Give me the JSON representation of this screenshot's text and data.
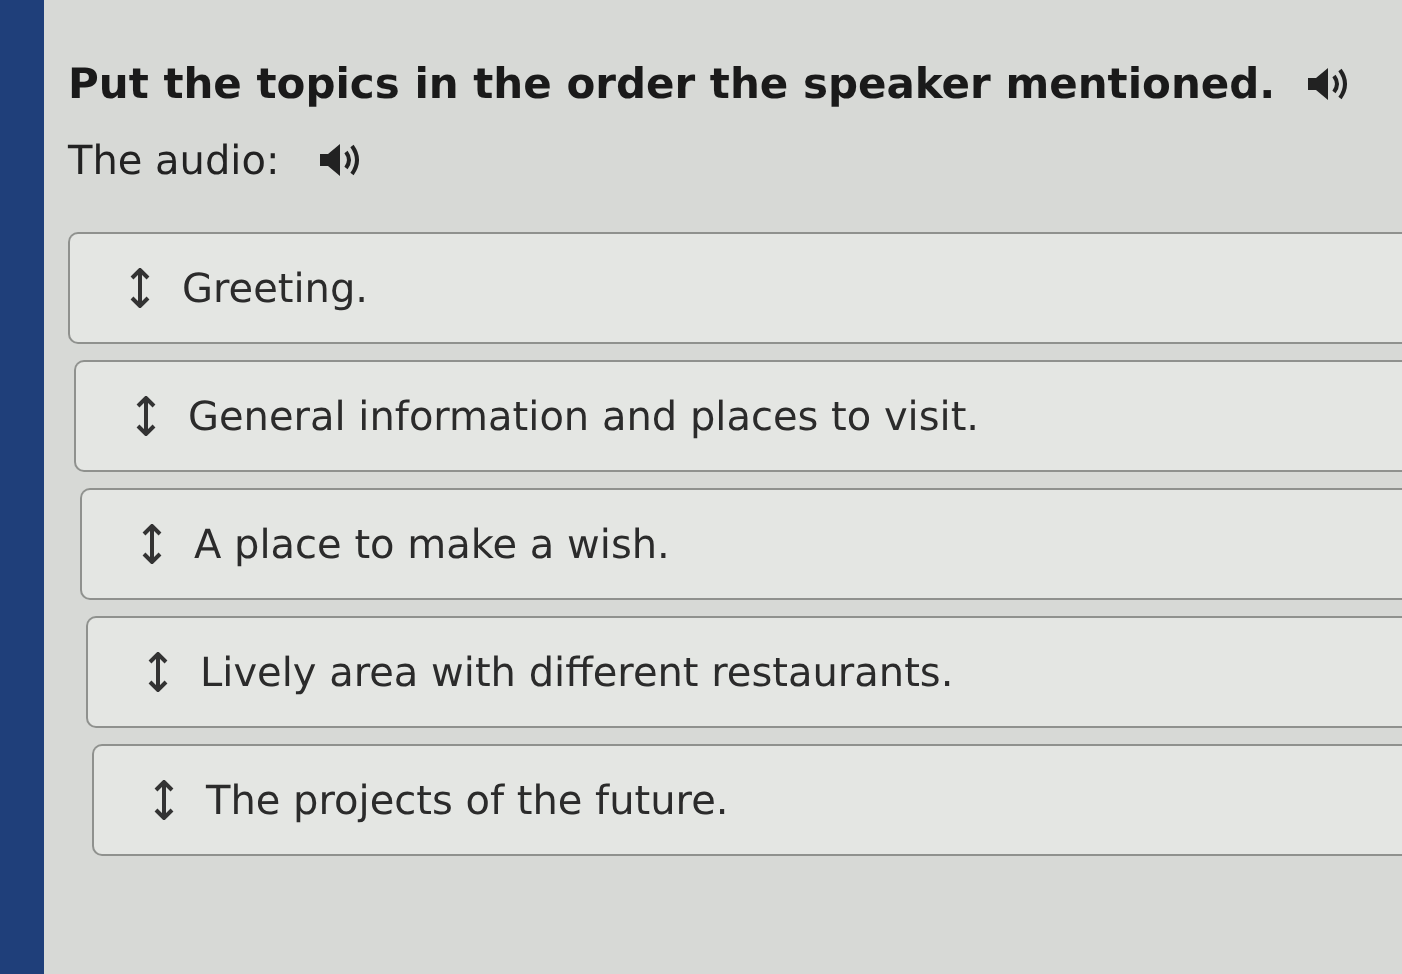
{
  "question": {
    "prompt": "Put the topics in the order the speaker mentioned."
  },
  "audio": {
    "label": "The audio:"
  },
  "items": [
    {
      "text": "Greeting."
    },
    {
      "text": "General information and places to visit."
    },
    {
      "text": "A place to make a wish."
    },
    {
      "text": "Lively area with different restaurants."
    },
    {
      "text": "The projects of the future."
    }
  ]
}
